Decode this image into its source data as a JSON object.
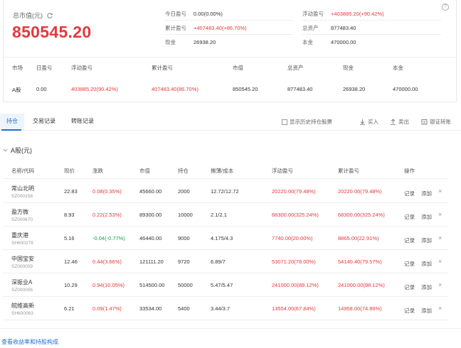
{
  "summary_card": {
    "total_label": "总市值(元)",
    "total_value": "850545.20",
    "today_pl_label": "今日盈亏",
    "today_pl_value": "0.00(0.00%)",
    "cum_pl_label": "累计盈亏",
    "cum_pl_value": "+407483.40(+86.70%)",
    "cash_label": "现金",
    "cash_value": "26938.20",
    "float_pl_label": "浮动盈亏",
    "float_pl_value": "+403885.20(+90.42%)",
    "total_assets_label": "总资产",
    "total_assets_value": "877483.40",
    "principal_label": "本金",
    "principal_value": "470000.00",
    "help": "?"
  },
  "market_summary": {
    "headers": [
      "市场",
      "日盈亏",
      "浮动盈亏",
      "累计盈亏",
      "市值",
      "总资产",
      "现金",
      "本金"
    ],
    "row": [
      "A股",
      "0.00",
      "403885.20(90.42%)",
      "407483.40(86.70%)",
      "850545.20",
      "877483.40",
      "26938.20",
      "470000.00"
    ]
  },
  "tabs": [
    "持仓",
    "交易记录",
    "转账记录"
  ],
  "toolbar": {
    "show_history": "显示历史持仓股票",
    "buy": "买入",
    "sell": "卖出",
    "transfer": "银证转账"
  },
  "section_title": "A股(元)",
  "holdings": {
    "headers": [
      "名称/代码",
      "现价",
      "涨跌",
      "市值",
      "持仓",
      "摊薄/成本",
      "浮动盈亏",
      "累计盈亏",
      "操作"
    ],
    "rows": [
      {
        "name": "常山北明",
        "code": "SZ000158",
        "price": "22.83",
        "change": "0.08(0.35%)",
        "mv": "45660.00",
        "qty": "2000",
        "cost": "12.72/12.72",
        "float": "20220.00(79.48%)",
        "cum": "20220.00(79.48%)",
        "dir": "up"
      },
      {
        "name": "盈方微",
        "code": "SZ000670",
        "price": "8.93",
        "change": "0.22(2.53%)",
        "mv": "89300.00",
        "qty": "10000",
        "cost": "2.1/2.1",
        "float": "68300.00(325.24%)",
        "cum": "68300.00(325.24%)",
        "dir": "up"
      },
      {
        "name": "重庆港",
        "code": "SH600279",
        "price": "5.16",
        "change": "-0.04(-0.77%)",
        "mv": "46440.00",
        "qty": "9000",
        "cost": "4.175/4.3",
        "float": "7740.00(20.00%)",
        "cum": "8865.00(22.91%)",
        "dir": "down"
      },
      {
        "name": "中国宝安",
        "code": "SZ000009",
        "price": "12.46",
        "change": "0.44(3.66%)",
        "mv": "121111.20",
        "qty": "9720",
        "cost": "6.89/7",
        "float": "53071.20(78.00%)",
        "cum": "54140.40(79.57%)",
        "dir": "up"
      },
      {
        "name": "深振业A",
        "code": "SZ000006",
        "price": "10.29",
        "change": "0.94(10.05%)",
        "mv": "514500.00",
        "qty": "50000",
        "cost": "5.47/5.47",
        "float": "241000.00(88.12%)",
        "cum": "241000.00(88.12%)",
        "dir": "up"
      },
      {
        "name": "皖维高新",
        "code": "SH600063",
        "price": "6.21",
        "change": "0.09(1.47%)",
        "mv": "33534.00",
        "qty": "5400",
        "cost": "3.44/3.7",
        "float": "13554.00(67.84%)",
        "cum": "14958.00(74.86%)",
        "dir": "up"
      }
    ],
    "actions": {
      "record": "记录",
      "add": "添加",
      "remove": "×"
    }
  },
  "bottom_link": "查看收益率和持股构成",
  "colors": {
    "up": "#e4393c",
    "down": "#18a058",
    "accent": "#1e6fd9"
  }
}
